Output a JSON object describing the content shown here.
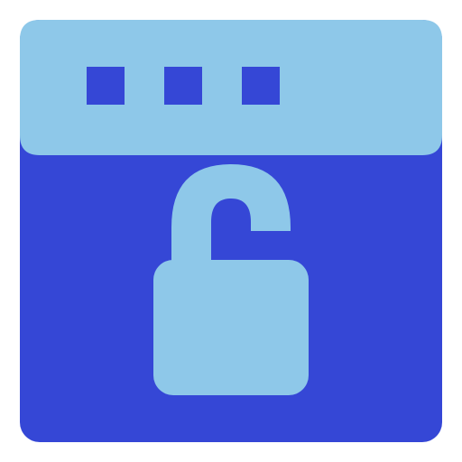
{
  "icon": {
    "name": "browser-window-unlocked-icon",
    "colors": {
      "window_body": "#3547d6",
      "title_bar": "#8ec8e9",
      "window_dots": "#3547d6",
      "padlock": "#8ec8e9",
      "background": "#ffffff"
    }
  }
}
